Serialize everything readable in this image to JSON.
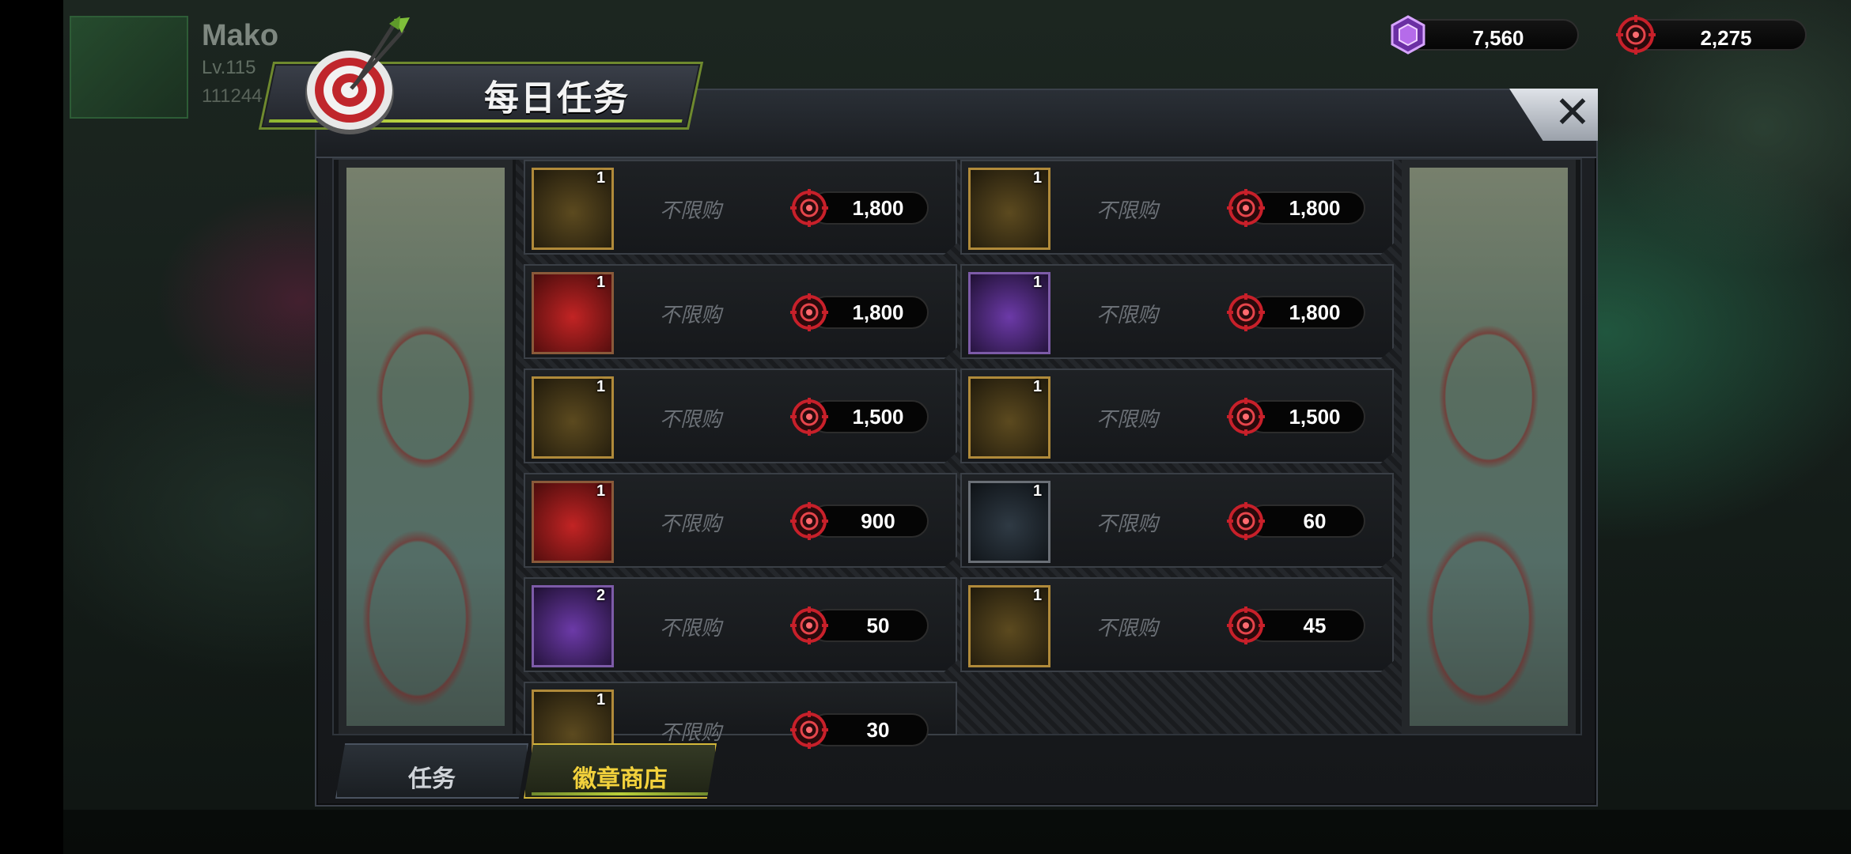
{
  "player": {
    "name": "Mako",
    "level": "Lv.115",
    "id": "111244"
  },
  "currencies": [
    {
      "icon": "purple-gem-icon",
      "amount": "7,560",
      "color": "#a34bd6"
    },
    {
      "icon": "red-badge-coin-icon",
      "amount": "2,275",
      "color": "#c8202a"
    }
  ],
  "panel": {
    "title": "每日任务",
    "close_label": "✕"
  },
  "shop_items": [
    {
      "count": "1",
      "limit": "不限购",
      "price": "1,800",
      "icon": "sss-treasure-chest-icon"
    },
    {
      "count": "1",
      "limit": "不限购",
      "price": "1,800",
      "icon": "gold-crate-icon"
    },
    {
      "count": "1",
      "limit": "不限购",
      "price": "1,800",
      "icon": "red-shard-icon"
    },
    {
      "count": "1",
      "limit": "不限购",
      "price": "1,800",
      "icon": "gem-chest-icon"
    },
    {
      "count": "1",
      "limit": "不限购",
      "price": "1,500",
      "icon": "ruby-chest-icon"
    },
    {
      "count": "1",
      "limit": "不限购",
      "price": "1,500",
      "icon": "emerald-chest-icon"
    },
    {
      "count": "1",
      "limit": "不限购",
      "price": "900",
      "icon": "hammer-icon"
    },
    {
      "count": "1",
      "limit": "不限购",
      "price": "60",
      "icon": "energy-orb-icon"
    },
    {
      "count": "2",
      "limit": "不限购",
      "price": "50",
      "icon": "poker-chip-icon"
    },
    {
      "count": "1",
      "limit": "不限购",
      "price": "45",
      "icon": "shuriken-icon"
    },
    {
      "count": "1",
      "limit": "不限购",
      "price": "30",
      "icon": "crystal-pack-icon"
    }
  ],
  "tabs": [
    {
      "label": "任务",
      "active": false
    },
    {
      "label": "徽章商店",
      "active": true
    }
  ],
  "colors": {
    "accent_green": "#8fb531",
    "accent_gold": "#f2d13c",
    "price_red": "#c8202a"
  }
}
